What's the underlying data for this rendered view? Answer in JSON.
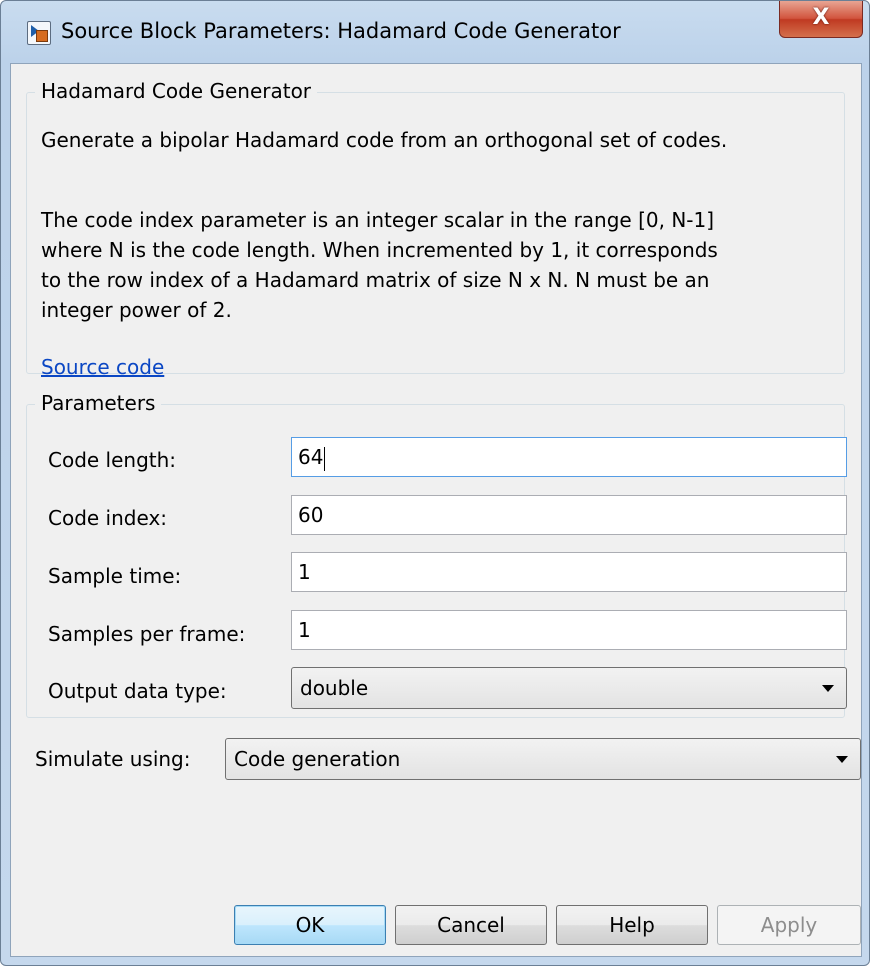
{
  "window": {
    "title": "Source Block Parameters: Hadamard Code Generator",
    "close_glyph": "X"
  },
  "description_group": {
    "title": "Hadamard Code Generator",
    "line1": "Generate a bipolar Hadamard code from an orthogonal set of codes.",
    "paragraph2": "The code index parameter is an integer scalar in the range [0, N-1]\nwhere N is the code length.  When incremented by 1, it corresponds\nto the row index of a Hadamard matrix of size N x N. N must be an\ninteger power of 2.",
    "link": "Source code"
  },
  "parameters": {
    "title": "Parameters",
    "code_length": {
      "label": "Code length:",
      "value": "64"
    },
    "code_index": {
      "label": "Code index:",
      "value": "60"
    },
    "sample_time": {
      "label": "Sample time:",
      "value": "1"
    },
    "samples_per_frame": {
      "label": "Samples per frame:",
      "value": "1"
    },
    "output_data_type": {
      "label": "Output data type:",
      "value": "double"
    }
  },
  "simulate": {
    "label": "Simulate using:",
    "value": "Code generation"
  },
  "buttons": {
    "ok": "OK",
    "cancel": "Cancel",
    "help": "Help",
    "apply": "Apply"
  },
  "colors": {
    "link": "#0b47c4",
    "close_button": "#c9462c",
    "focus_border": "#569de5"
  }
}
